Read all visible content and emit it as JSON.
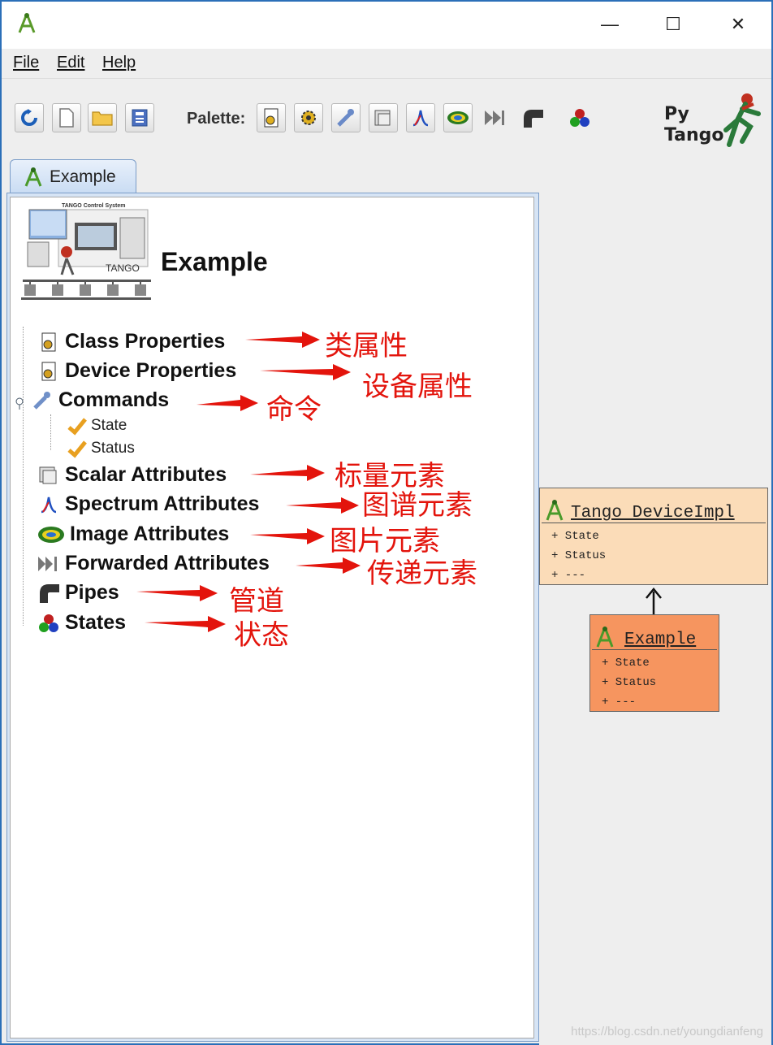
{
  "window": {
    "controls": {
      "minimize": "—",
      "maximize": "☐",
      "close": "✕"
    }
  },
  "menu": {
    "file": "File",
    "edit": "Edit",
    "help": "Help"
  },
  "toolbar": {
    "palette_label": "Palette:",
    "logo_line1": "Py",
    "logo_line2": "Tango"
  },
  "tab": {
    "label": "Example"
  },
  "tree": {
    "root": "Example",
    "hero_caption": "TANGO Control System",
    "hero_logo_text": "TANGO",
    "items": [
      {
        "label": "Class Properties",
        "annotation": "类属性"
      },
      {
        "label": "Device Properties",
        "annotation": "设备属性"
      },
      {
        "label": "Commands",
        "annotation": "命令"
      },
      {
        "label": "Scalar Attributes",
        "annotation": "标量元素"
      },
      {
        "label": "Spectrum Attributes",
        "annotation": "图谱元素"
      },
      {
        "label": "Image Attributes",
        "annotation": "图片元素"
      },
      {
        "label": "Forwarded Attributes",
        "annotation": "传递元素"
      },
      {
        "label": "Pipes",
        "annotation": "管道"
      },
      {
        "label": "States",
        "annotation": "状态"
      }
    ],
    "commands": [
      "State",
      "Status"
    ]
  },
  "uml": {
    "parent": {
      "title": "Tango DeviceImpl",
      "attrs": [
        "+ State",
        "+ Status",
        "+ ---"
      ],
      "color": "#fbdcb8"
    },
    "child": {
      "title": "Example",
      "attrs": [
        "+ State",
        "+ Status",
        "+ ---"
      ],
      "color": "#f6955f"
    }
  },
  "annotation_color": "#e3140c",
  "watermark": "https://blog.csdn.net/youngdianfeng"
}
